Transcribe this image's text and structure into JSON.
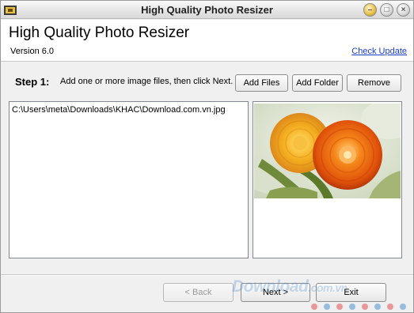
{
  "window": {
    "title": "High Quality Photo Resizer",
    "controls": {
      "minimize": "–",
      "maximize": "□",
      "close": "×"
    }
  },
  "header": {
    "app_title": "High Quality Photo Resizer",
    "version": "Version 6.0",
    "check_update": "Check Update"
  },
  "step": {
    "label": "Step 1:",
    "instruction": "Add one or more image files, then click Next."
  },
  "toolbar": {
    "add_files": "Add Files",
    "add_folder": "Add Folder",
    "remove": "Remove"
  },
  "file_list": {
    "items": [
      "C:\\Users\\meta\\Downloads\\KHAC\\Download.com.vn.jpg"
    ]
  },
  "preview": {
    "icon": "flower-image"
  },
  "footer": {
    "back": "< Back",
    "next": "Next >",
    "exit": "Exit"
  },
  "watermark": {
    "brand": "Download",
    "suffix": ".com.vn"
  },
  "colors": {
    "link": "#1a3dcc",
    "flower_orange": "#f07a10",
    "flower_yellow": "#f5b020"
  }
}
